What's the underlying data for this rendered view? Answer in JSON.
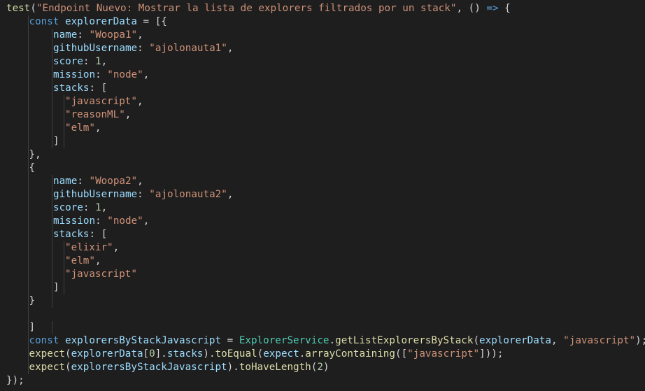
{
  "editor": {
    "language": "javascript",
    "theme_colors": {
      "background": "#1e1e1e",
      "default": "#d4d4d4",
      "function": "#dcdcaa",
      "string": "#ce9178",
      "keyword": "#569cd6",
      "variable": "#9cdcfe",
      "number": "#b5cea8",
      "class": "#4ec9b0",
      "indent_guide": "#404040"
    },
    "lines": [
      {
        "indent": 0,
        "tokens": [
          {
            "t": "yellow",
            "v": "test"
          },
          {
            "t": "punct",
            "v": "("
          },
          {
            "t": "string",
            "v": "\"Endpoint Nuevo: Mostrar la lista de explorers filtrados por un stack\""
          },
          {
            "t": "punct",
            "v": ", () "
          },
          {
            "t": "keyword",
            "v": "=>"
          },
          {
            "t": "punct",
            "v": " {"
          }
        ]
      },
      {
        "indent": 1,
        "tokens": [
          {
            "t": "keyword",
            "v": "const"
          },
          {
            "t": "punct",
            "v": " "
          },
          {
            "t": "var",
            "v": "explorerData"
          },
          {
            "t": "punct",
            "v": " = [{"
          }
        ]
      },
      {
        "indent": 2,
        "tokens": [
          {
            "t": "prop",
            "v": "name"
          },
          {
            "t": "punct",
            "v": ": "
          },
          {
            "t": "string",
            "v": "\"Woopa1\""
          },
          {
            "t": "punct",
            "v": ","
          }
        ]
      },
      {
        "indent": 2,
        "tokens": [
          {
            "t": "prop",
            "v": "githubUsername"
          },
          {
            "t": "punct",
            "v": ": "
          },
          {
            "t": "string",
            "v": "\"ajolonauta1\""
          },
          {
            "t": "punct",
            "v": ","
          }
        ]
      },
      {
        "indent": 2,
        "tokens": [
          {
            "t": "prop",
            "v": "score"
          },
          {
            "t": "punct",
            "v": ": "
          },
          {
            "t": "number",
            "v": "1"
          },
          {
            "t": "punct",
            "v": ","
          }
        ]
      },
      {
        "indent": 2,
        "tokens": [
          {
            "t": "prop",
            "v": "mission"
          },
          {
            "t": "punct",
            "v": ": "
          },
          {
            "t": "string",
            "v": "\"node\""
          },
          {
            "t": "punct",
            "v": ","
          }
        ]
      },
      {
        "indent": 2,
        "tokens": [
          {
            "t": "prop",
            "v": "stacks"
          },
          {
            "t": "punct",
            "v": ": ["
          }
        ]
      },
      {
        "indent": 3,
        "tokens": [
          {
            "t": "string",
            "v": "\"javascript\""
          },
          {
            "t": "punct",
            "v": ","
          }
        ]
      },
      {
        "indent": 3,
        "tokens": [
          {
            "t": "string",
            "v": "\"reasonML\""
          },
          {
            "t": "punct",
            "v": ","
          }
        ]
      },
      {
        "indent": 3,
        "tokens": [
          {
            "t": "string",
            "v": "\"elm\""
          },
          {
            "t": "punct",
            "v": ","
          }
        ]
      },
      {
        "indent": 2,
        "guides": 3,
        "tokens": [
          {
            "t": "punct",
            "v": "]"
          }
        ]
      },
      {
        "indent": 1,
        "tokens": [
          {
            "t": "punct",
            "v": "},"
          }
        ]
      },
      {
        "indent": 1,
        "tokens": [
          {
            "t": "punct",
            "v": "{"
          }
        ]
      },
      {
        "indent": 2,
        "tokens": [
          {
            "t": "prop",
            "v": "name"
          },
          {
            "t": "punct",
            "v": ": "
          },
          {
            "t": "string",
            "v": "\"Woopa2\""
          },
          {
            "t": "punct",
            "v": ","
          }
        ]
      },
      {
        "indent": 2,
        "tokens": [
          {
            "t": "prop",
            "v": "githubUsername"
          },
          {
            "t": "punct",
            "v": ": "
          },
          {
            "t": "string",
            "v": "\"ajolonauta2\""
          },
          {
            "t": "punct",
            "v": ","
          }
        ]
      },
      {
        "indent": 2,
        "tokens": [
          {
            "t": "prop",
            "v": "score"
          },
          {
            "t": "punct",
            "v": ": "
          },
          {
            "t": "number",
            "v": "1"
          },
          {
            "t": "punct",
            "v": ","
          }
        ]
      },
      {
        "indent": 2,
        "tokens": [
          {
            "t": "prop",
            "v": "mission"
          },
          {
            "t": "punct",
            "v": ": "
          },
          {
            "t": "string",
            "v": "\"node\""
          },
          {
            "t": "punct",
            "v": ","
          }
        ]
      },
      {
        "indent": 2,
        "tokens": [
          {
            "t": "prop",
            "v": "stacks"
          },
          {
            "t": "punct",
            "v": ": ["
          }
        ]
      },
      {
        "indent": 3,
        "tokens": [
          {
            "t": "string",
            "v": "\"elixir\""
          },
          {
            "t": "punct",
            "v": ","
          }
        ]
      },
      {
        "indent": 3,
        "tokens": [
          {
            "t": "string",
            "v": "\"elm\""
          },
          {
            "t": "punct",
            "v": ","
          }
        ]
      },
      {
        "indent": 3,
        "tokens": [
          {
            "t": "string",
            "v": "\"javascript\""
          }
        ]
      },
      {
        "indent": 2,
        "guides": 3,
        "tokens": [
          {
            "t": "punct",
            "v": "]"
          }
        ]
      },
      {
        "indent": 1,
        "guides": 2,
        "tokens": [
          {
            "t": "punct",
            "v": "}"
          }
        ]
      },
      {
        "indent": 0,
        "guides": 1,
        "tokens": []
      },
      {
        "indent": 1,
        "guides": 2,
        "tokens": [
          {
            "t": "punct",
            "v": "]"
          }
        ]
      },
      {
        "indent": 1,
        "tokens": [
          {
            "t": "keyword",
            "v": "const"
          },
          {
            "t": "punct",
            "v": " "
          },
          {
            "t": "var",
            "v": "explorersByStackJavascript"
          },
          {
            "t": "punct",
            "v": " = "
          },
          {
            "t": "class",
            "v": "ExplorerService"
          },
          {
            "t": "punct",
            "v": "."
          },
          {
            "t": "yellow",
            "v": "getListExplorersByStack"
          },
          {
            "t": "punct",
            "v": "("
          },
          {
            "t": "var",
            "v": "explorerData"
          },
          {
            "t": "punct",
            "v": ", "
          },
          {
            "t": "string",
            "v": "\"javascript\""
          },
          {
            "t": "punct",
            "v": ");"
          }
        ]
      },
      {
        "indent": 1,
        "tokens": [
          {
            "t": "yellow",
            "v": "expect"
          },
          {
            "t": "punct",
            "v": "("
          },
          {
            "t": "var",
            "v": "explorerData"
          },
          {
            "t": "punct",
            "v": "["
          },
          {
            "t": "number",
            "v": "0"
          },
          {
            "t": "punct",
            "v": "]."
          },
          {
            "t": "var",
            "v": "stacks"
          },
          {
            "t": "punct",
            "v": ")."
          },
          {
            "t": "yellow",
            "v": "toEqual"
          },
          {
            "t": "punct",
            "v": "("
          },
          {
            "t": "var",
            "v": "expect"
          },
          {
            "t": "punct",
            "v": "."
          },
          {
            "t": "yellow",
            "v": "arrayContaining"
          },
          {
            "t": "punct",
            "v": "(["
          },
          {
            "t": "string",
            "v": "\"javascript\""
          },
          {
            "t": "punct",
            "v": "]));"
          }
        ]
      },
      {
        "indent": 1,
        "tokens": [
          {
            "t": "yellow",
            "v": "expect"
          },
          {
            "t": "punct",
            "v": "("
          },
          {
            "t": "var",
            "v": "explorersByStackJavascript"
          },
          {
            "t": "punct",
            "v": ")."
          },
          {
            "t": "yellow",
            "v": "toHaveLength"
          },
          {
            "t": "punct",
            "v": "("
          },
          {
            "t": "number",
            "v": "2"
          },
          {
            "t": "punct",
            "v": ")"
          }
        ]
      },
      {
        "indent": 0,
        "tokens": [
          {
            "t": "punct",
            "v": "});"
          }
        ]
      }
    ]
  }
}
